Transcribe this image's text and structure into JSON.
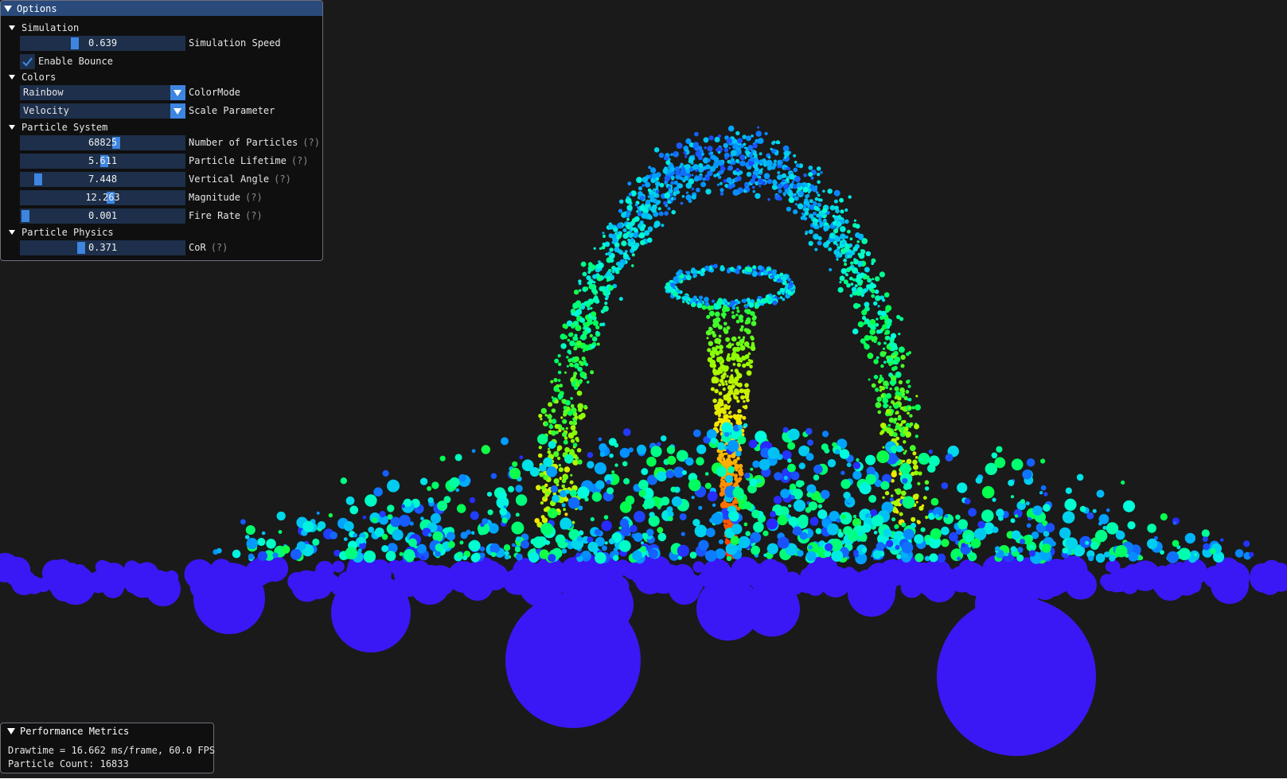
{
  "options": {
    "title": "Options",
    "simulation": {
      "header": "Simulation",
      "speed_value": "0.639",
      "speed_label": "Simulation Speed",
      "bounce_label": "Enable Bounce",
      "bounce_checked": true
    },
    "colors": {
      "header": "Colors",
      "color_mode_value": "Rainbow",
      "color_mode_label": "ColorMode",
      "scale_param_value": "Velocity",
      "scale_param_label": "Scale Parameter"
    },
    "particle_system": {
      "header": "Particle System",
      "num_particles_value": "68825",
      "num_particles_label": "Number of Particles",
      "lifetime_value": "5.611",
      "lifetime_label": "Particle Lifetime",
      "vertical_angle_value": "7.448",
      "vertical_angle_label": "Vertical Angle",
      "magnitude_value": "12.263",
      "magnitude_label": "Magnitude",
      "fire_rate_value": "0.001",
      "fire_rate_label": "Fire Rate",
      "help": "(?)"
    },
    "particle_physics": {
      "header": "Particle Physics",
      "cor_value": "0.371",
      "cor_label": "CoR"
    }
  },
  "performance": {
    "title": "Performance Metrics",
    "drawtime_line": "Drawtime = 16.662 ms/frame, 60.0 FPS",
    "count_line": "Particle Count: 16833"
  },
  "slider_fractions": {
    "speed": 0.32,
    "num_particles": 0.59,
    "lifetime": 0.51,
    "vertical_angle": 0.08,
    "magnitude": 0.55,
    "fire_rate": 0.0,
    "cor": 0.36
  },
  "colors_hex": {
    "background": "#1a1a1a",
    "title_bar": "#294a7a",
    "widget_bg": "#1d2f4a",
    "accent": "#3d85e0",
    "ground_blue": "#3a18f5"
  }
}
